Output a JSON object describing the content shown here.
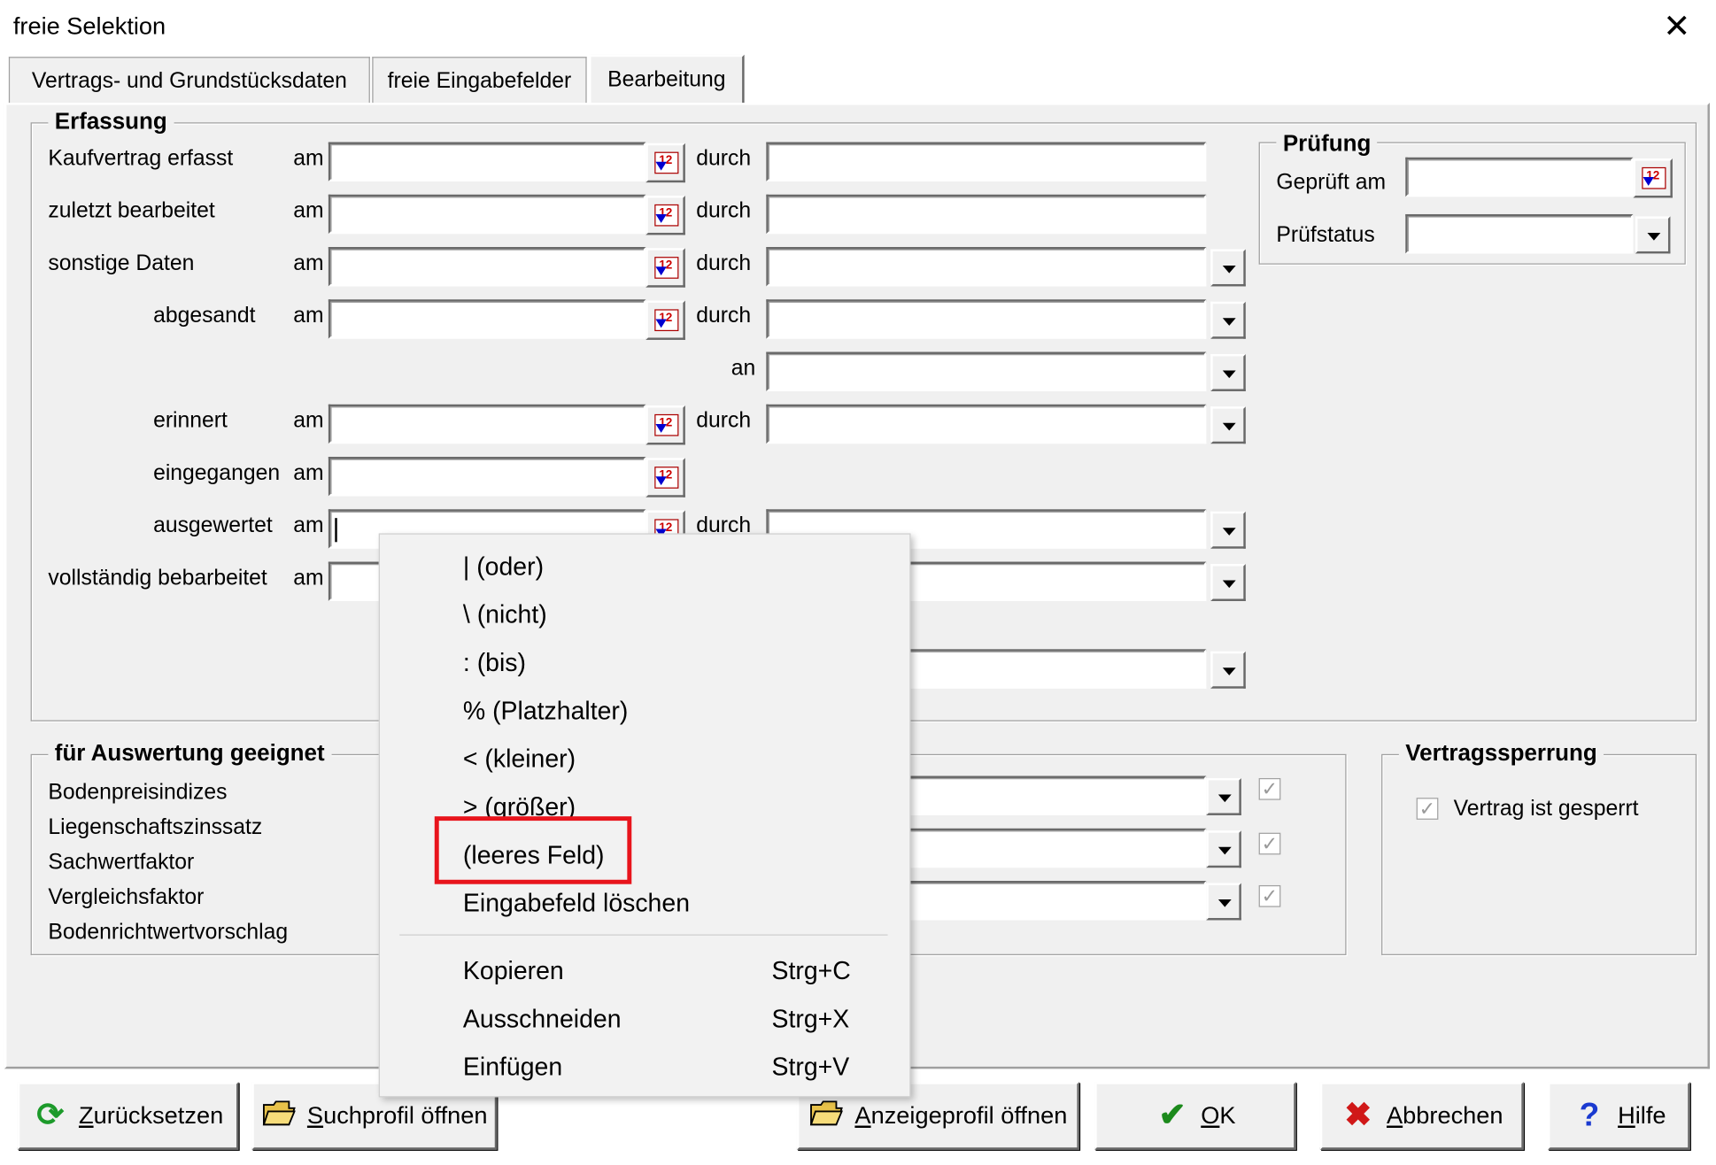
{
  "window": {
    "title": "freie Selektion",
    "close_symbol": "✕"
  },
  "tabs": [
    {
      "label": "Vertrags- und Grundstücksdaten",
      "active": false
    },
    {
      "label": "freie Eingabefelder",
      "active": false
    },
    {
      "label": "Bearbeitung",
      "active": true
    }
  ],
  "erfassung": {
    "legend": "Erfassung",
    "word_am": "am",
    "word_durch": "durch",
    "word_an": "an",
    "rows": {
      "kaufvertrag": "Kaufvertrag erfasst",
      "zuletzt": "zuletzt bearbeitet",
      "sonstige": "sonstige Daten",
      "abgesandt": "abgesandt",
      "erinnert": "erinnert",
      "eingegangen": "eingegangen",
      "ausgewertet": "ausgewertet",
      "vollstaendig": "vollständig bebarbeitet"
    }
  },
  "pruefung": {
    "legend": "Prüfung",
    "geprueft_am": "Geprüft am",
    "pruefstatus": "Prüfstatus"
  },
  "auswertung": {
    "legend": "für Auswertung geeignet",
    "items": [
      "Bodenpreisindizes",
      "Liegenschaftszinssatz",
      "Sachwertfaktor",
      "Vergleichsfaktor",
      "Bodenrichtwertvorschlag"
    ]
  },
  "vertragssperrung": {
    "legend": "Vertragssperrung",
    "checkbox_label": "Vertrag ist gesperrt",
    "checked": true
  },
  "context_menu": {
    "items": [
      "|  (oder)",
      "\\  (nicht)",
      ":  (bis)",
      "%  (Platzhalter)",
      "<  (kleiner)",
      ">  (größer)",
      "(leeres Feld)",
      "Eingabefeld löschen"
    ],
    "clipboard": [
      {
        "label": "Kopieren",
        "shortcut": "Strg+C"
      },
      {
        "label": "Ausschneiden",
        "shortcut": "Strg+X"
      },
      {
        "label": "Einfügen",
        "shortcut": "Strg+V"
      }
    ],
    "highlighted": "(leeres Feld)",
    "highlight_color": "#e8141c"
  },
  "buttons": {
    "reset": "Zurücksetzen",
    "suchprofil": "Suchprofil öffnen",
    "anzeigeprofil": "Anzeigeprofil öffnen",
    "ok": "OK",
    "abbrechen": "Abbrechen",
    "hilfe": "Hilfe"
  },
  "icons": {
    "close": "close-icon",
    "calendar": "calendar-icon",
    "dropdown": "chevron-down-icon",
    "reset": "refresh-icon",
    "folder": "folder-open-icon",
    "ok": "checkmark-icon",
    "cancel": "cross-icon",
    "help": "question-icon"
  }
}
